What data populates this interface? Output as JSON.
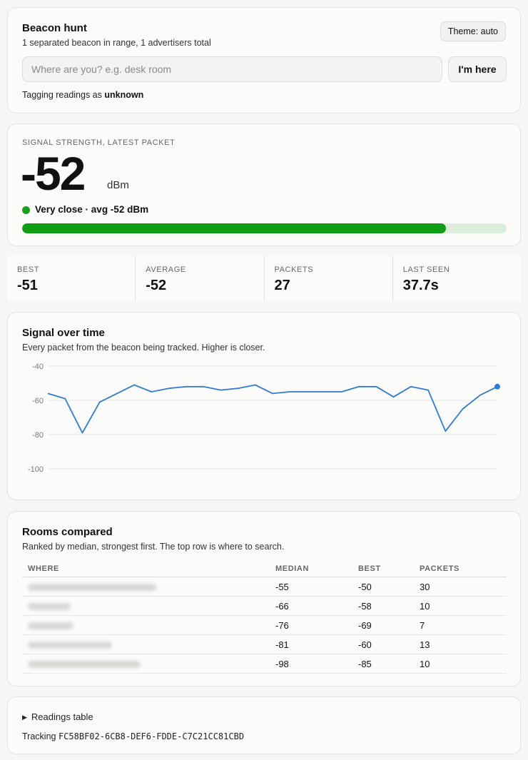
{
  "header": {
    "title": "Beacon hunt",
    "subtitle": "1 separated beacon in range, 1 advertisers total",
    "theme_label": "Theme: auto",
    "location_placeholder": "Where are you? e.g. desk room",
    "location_value": "",
    "im_here_label": "I'm here",
    "tagging_prefix": "Tagging readings as",
    "tagging_value": "unknown"
  },
  "signal": {
    "label": "SIGNAL STRENGTH, LATEST PACKET",
    "value": "-52",
    "unit": "dBm",
    "status": "Very close · avg -52 dBm",
    "status_color": "#15a11b",
    "bar_fraction": 0.875
  },
  "stats": [
    {
      "label": "BEST",
      "value": "-51"
    },
    {
      "label": "AVERAGE",
      "value": "-52"
    },
    {
      "label": "PACKETS",
      "value": "27"
    },
    {
      "label": "LAST SEEN",
      "value": "37.7s"
    }
  ],
  "chart": {
    "title": "Signal over time",
    "subtitle": "Every packet from the beacon being tracked. Higher is closer."
  },
  "chart_data": {
    "type": "line",
    "title": "Signal over time",
    "xlabel": "",
    "ylabel": "",
    "ylim": [
      -100,
      -40
    ],
    "yticks": [
      "-40",
      "-60",
      "-80",
      "-100"
    ],
    "grid": true,
    "line_color": "#2f7bd6",
    "x": [
      1,
      2,
      3,
      4,
      5,
      6,
      7,
      8,
      9,
      10,
      11,
      12,
      13,
      14,
      15,
      16,
      17,
      18,
      19,
      20,
      21,
      22,
      23,
      24,
      25,
      26,
      27
    ],
    "values": [
      -56,
      -59,
      -79,
      -61,
      -56,
      -51,
      -55,
      -53,
      -52,
      -52,
      -54,
      -53,
      -51,
      -56,
      -55,
      -55,
      -55,
      -55,
      -52,
      -52,
      -58,
      -52,
      -54,
      -78,
      -65,
      -57,
      -52
    ]
  },
  "rooms": {
    "title": "Rooms compared",
    "subtitle": "Ranked by median, strongest first. The top row is where to search.",
    "columns": [
      "WHERE",
      "MEDIAN",
      "BEST",
      "PACKETS"
    ],
    "rows": [
      {
        "median": "-55",
        "best": "-50",
        "packets": "30"
      },
      {
        "median": "-66",
        "best": "-58",
        "packets": "10"
      },
      {
        "median": "-76",
        "best": "-69",
        "packets": "7"
      },
      {
        "median": "-81",
        "best": "-60",
        "packets": "13"
      },
      {
        "median": "-98",
        "best": "-85",
        "packets": "10"
      }
    ]
  },
  "footer": {
    "disclosure_label": "Readings table",
    "tracking_prefix": "Tracking",
    "tracking_id": "FC58BF02-6CB8-DEF6-FDDE-C7C21CC81CBD"
  }
}
